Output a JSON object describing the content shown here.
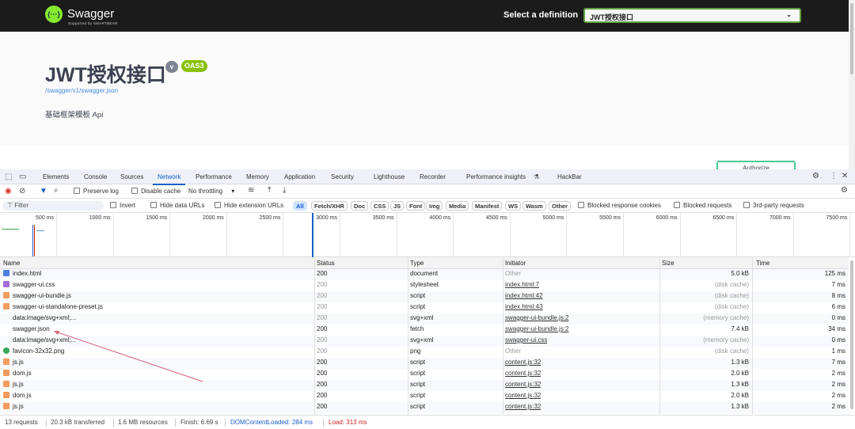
{
  "swagger": {
    "brand": "Swagger",
    "brand_sub": "Supported by SMARTBEAR",
    "select_label": "Select a definition",
    "select_value": "JWT授权接口",
    "title": "JWT授权接口",
    "version_badge": "v",
    "oas_badge": "OAS3",
    "spec_url": "/swagger/v1/swagger.json",
    "description": "基础框架模板 Api",
    "authorize_label": "Authorize"
  },
  "devtools": {
    "tabs": [
      "Elements",
      "Console",
      "Sources",
      "Network",
      "Performance",
      "Memory",
      "Application",
      "Security",
      "Lighthouse",
      "Recorder",
      "Performance insights",
      "HackBar"
    ],
    "active_tab": "Network",
    "toolbar": {
      "preserve_log": "Preserve log",
      "disable_cache": "Disable cache",
      "throttling": "No throttling"
    },
    "filter": {
      "placeholder": "Filter",
      "invert": "Invert",
      "hide_data": "Hide data URLs",
      "hide_ext": "Hide extension URLs",
      "types": [
        "All",
        "Fetch/XHR",
        "Doc",
        "CSS",
        "JS",
        "Font",
        "Img",
        "Media",
        "Manifest",
        "WS",
        "Wasm",
        "Other"
      ],
      "active_type": "All",
      "blocked_cookies": "Blocked response cookies",
      "blocked_requests": "Blocked requests",
      "third_party": "3rd-party requests"
    },
    "timeline_ticks": [
      "500 ms",
      "1000 ms",
      "1500 ms",
      "2000 ms",
      "2500 ms",
      "3000 ms",
      "3500 ms",
      "4000 ms",
      "4500 ms",
      "5000 ms",
      "5500 ms",
      "6000 ms",
      "6500 ms",
      "7000 ms",
      "7500 ms"
    ],
    "columns": [
      "Name",
      "Status",
      "Type",
      "Initiator",
      "Size",
      "Time"
    ],
    "rows": [
      {
        "name": "index.html",
        "icon": "document",
        "status": "200",
        "type": "document",
        "initiator": "Other",
        "size": "5.0 kB",
        "time": "125 ms"
      },
      {
        "name": "swagger-ui.css",
        "icon": "stylesheet",
        "status": "200",
        "type": "stylesheet",
        "initiator": "index.html:7",
        "size": "(disk cache)",
        "time": "7 ms"
      },
      {
        "name": "swagger-ui-bundle.js",
        "icon": "script",
        "status": "200",
        "type": "script",
        "initiator": "index.html:42",
        "size": "(disk cache)",
        "time": "8 ms"
      },
      {
        "name": "swagger-ui-standalone-preset.js",
        "icon": "script",
        "status": "200",
        "type": "script",
        "initiator": "index.html:43",
        "size": "(disk cache)",
        "time": "6 ms"
      },
      {
        "name": "data:image/svg+xml;...",
        "icon": "svg",
        "status": "200",
        "type": "svg+xml",
        "initiator": "swagger-ui-bundle.js:2",
        "size": "(memory cache)",
        "time": "0 ms"
      },
      {
        "name": "swagger.json",
        "icon": "fetch",
        "status": "200",
        "type": "fetch",
        "initiator": "swagger-ui-bundle.js:2",
        "size": "7.4 kB",
        "time": "34 ms"
      },
      {
        "name": "data:image/svg+xml;...",
        "icon": "svg",
        "status": "200",
        "type": "svg+xml",
        "initiator": "swagger-ui.css",
        "size": "(memory cache)",
        "time": "0 ms"
      },
      {
        "name": "favicon-32x32.png",
        "icon": "image",
        "status": "200",
        "type": "png",
        "initiator": "Other",
        "size": "(disk cache)",
        "time": "1 ms"
      },
      {
        "name": "js.js",
        "icon": "script",
        "status": "200",
        "type": "script",
        "initiator": "content.js:32",
        "size": "1.3 kB",
        "time": "7 ms"
      },
      {
        "name": "dom.js",
        "icon": "script",
        "status": "200",
        "type": "script",
        "initiator": "content.js:32",
        "size": "2.0 kB",
        "time": "2 ms"
      },
      {
        "name": "js.js",
        "icon": "script",
        "status": "200",
        "type": "script",
        "initiator": "content.js:32",
        "size": "1.3 kB",
        "time": "2 ms"
      },
      {
        "name": "dom.js",
        "icon": "script",
        "status": "200",
        "type": "script",
        "initiator": "content.js:32",
        "size": "2.0 kB",
        "time": "2 ms"
      },
      {
        "name": "js.js",
        "icon": "script",
        "status": "200",
        "type": "script",
        "initiator": "content.js:32",
        "size": "1.3 kB",
        "time": "2 ms"
      }
    ],
    "footer": {
      "requests": "13 requests",
      "transferred": "20.3 kB transferred",
      "resources": "1.6 MB resources",
      "finish": "Finish: 6.69 s",
      "dcl": "DOMContentLoaded: 284 ms",
      "load": "Load: 313 ms"
    },
    "colors": {
      "dcl": "#1a5fc7",
      "load": "#c5221f",
      "annotation_arrow": "#d9607a"
    }
  }
}
